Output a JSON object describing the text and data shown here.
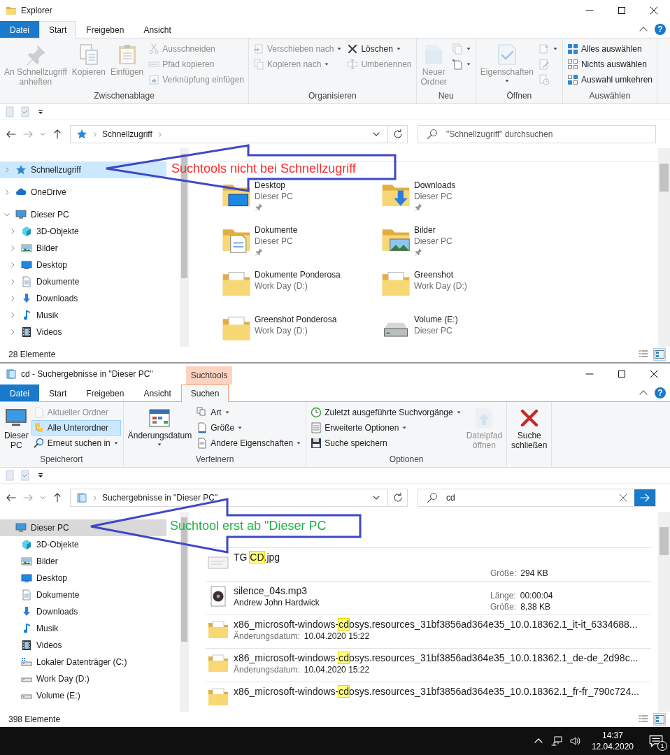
{
  "windows": [
    {
      "title": "Explorer",
      "nav_focus": true,
      "help": "?",
      "tabs": [
        {
          "label": "Datei",
          "kind": "file",
          "selected": false
        },
        {
          "label": "Start",
          "kind": "tab",
          "selected": true
        },
        {
          "label": "Freigeben",
          "kind": "tab",
          "selected": false
        },
        {
          "label": "Ansicht",
          "kind": "tab",
          "selected": false
        }
      ],
      "ribbon": [
        {
          "label": "Zwischenablage",
          "columns": [
            {
              "kind": "large",
              "label": "An Schnellzugriff\nanheften",
              "disabled": true
            },
            {
              "kind": "large",
              "label": "Kopieren",
              "disabled": true
            },
            {
              "kind": "large",
              "label": "Einfügen",
              "disabled": true
            },
            {
              "kind": "stack",
              "items": [
                {
                  "label": "Ausschneiden",
                  "disabled": true
                },
                {
                  "label": "Pfad kopieren",
                  "disabled": true
                },
                {
                  "label": "Verknüpfung einfügen",
                  "disabled": true
                }
              ]
            }
          ]
        },
        {
          "label": "Organisieren",
          "columns": [
            {
              "kind": "stack",
              "items": [
                {
                  "label": "Verschieben nach",
                  "disabled": true,
                  "dropdown": true
                },
                {
                  "label": "Kopieren nach",
                  "disabled": true,
                  "dropdown": true
                }
              ]
            },
            {
              "kind": "stack",
              "items": [
                {
                  "label": "Löschen",
                  "disabled": false,
                  "dropdown": true
                },
                {
                  "label": "Umbenennen",
                  "disabled": true
                }
              ]
            }
          ]
        },
        {
          "label": "Neu",
          "columns": [
            {
              "kind": "large",
              "label": "Neuer\nOrdner",
              "disabled": true
            },
            {
              "kind": "stack",
              "items": [
                {
                  "disabled": true,
                  "dropdown": true
                },
                {
                  "disabled": false,
                  "dropdown": true
                }
              ]
            }
          ]
        },
        {
          "label": "Öffnen",
          "columns": [
            {
              "kind": "large",
              "label": "Eigenschaften",
              "disabled": true,
              "dropdown": true
            },
            {
              "kind": "stack",
              "items": [
                {
                  "disabled": true,
                  "dropdown": true
                },
                {
                  "disabled": true
                },
                {
                  "disabled": true
                }
              ]
            }
          ]
        },
        {
          "label": "Auswählen",
          "columns": [
            {
              "kind": "stack",
              "items": [
                {
                  "label": "Alles auswählen",
                  "disabled": false
                },
                {
                  "label": "Nichts auswählen",
                  "disabled": false
                },
                {
                  "label": "Auswahl umkehren",
                  "disabled": false
                }
              ]
            }
          ]
        }
      ],
      "address": {
        "crumbs": [
          "Schnellzugriff"
        ],
        "trailing_chevron": true
      },
      "search": {
        "placeholder": "\"Schnellzugriff\" durchsuchen"
      },
      "nav": [
        {
          "label": "Schnellzugriff",
          "expanded": false,
          "selected": true
        },
        {
          "label": "OneDrive",
          "expanded": false,
          "selected": false
        },
        {
          "label": "Dieser PC",
          "expanded": true,
          "selected": false,
          "children": [
            {
              "label": "3D-Objekte",
              "expanded": false,
              "selected": false
            },
            {
              "label": "Bilder",
              "expanded": false,
              "selected": false
            },
            {
              "label": "Desktop",
              "expanded": false,
              "selected": false
            },
            {
              "label": "Dokumente",
              "expanded": false,
              "selected": false
            },
            {
              "label": "Downloads",
              "expanded": false,
              "selected": false
            },
            {
              "label": "Musik",
              "expanded": false,
              "selected": false
            },
            {
              "label": "Videos",
              "expanded": false,
              "selected": false
            }
          ]
        }
      ],
      "content": {
        "kind": "tiles",
        "tiles": [
          {
            "name": "Desktop",
            "location": "Dieser PC",
            "pinned": true
          },
          {
            "name": "Downloads",
            "location": "Dieser PC",
            "pinned": true
          },
          {
            "name": "Dokumente",
            "location": "Dieser PC",
            "pinned": true
          },
          {
            "name": "Bilder",
            "location": "Dieser PC",
            "pinned": true
          },
          {
            "name": "Dokumente Ponderosa",
            "location": "Work Day (D:)",
            "pinned": false
          },
          {
            "name": "Greenshot",
            "location": "Work Day (D:)",
            "pinned": false
          },
          {
            "name": "Greenshot Ponderosa",
            "location": "Work Day (D:)",
            "pinned": false
          },
          {
            "name": "Volume (E:)",
            "location": "Dieser PC",
            "pinned": false
          }
        ]
      },
      "status": "28 Elemente"
    },
    {
      "title": "cd - Suchergebnisse in \"Dieser PC\"",
      "context_label": "Suchtools",
      "nav_focus": false,
      "help": "?",
      "tabs": [
        {
          "label": "Datei",
          "kind": "file",
          "selected": false
        },
        {
          "label": "Start",
          "kind": "tab",
          "selected": false
        },
        {
          "label": "Freigeben",
          "kind": "tab",
          "selected": false
        },
        {
          "label": "Ansicht",
          "kind": "tab",
          "selected": false
        },
        {
          "label": "Suchen",
          "kind": "context",
          "selected": true
        }
      ],
      "ribbon": [
        {
          "label": "Speicherort",
          "columns": [
            {
              "kind": "large",
              "label": "Dieser\nPC",
              "disabled": false
            },
            {
              "kind": "stack",
              "items": [
                {
                  "label": "Aktueller Ordner",
                  "disabled": true,
                  "selected": false
                },
                {
                  "label": "Alle Unterordner",
                  "disabled": false,
                  "selected": true
                },
                {
                  "label": "Erneut suchen in",
                  "disabled": false,
                  "selected": false,
                  "dropdown": true
                }
              ]
            }
          ]
        },
        {
          "label": "Verfeinern",
          "columns": [
            {
              "kind": "large",
              "label": "Änderungsdatum",
              "disabled": false,
              "dropdown": true
            },
            {
              "kind": "stack",
              "items": [
                {
                  "label": "Art",
                  "disabled": false,
                  "dropdown": true
                },
                {
                  "label": "Größe",
                  "disabled": false,
                  "dropdown": true
                },
                {
                  "label": "Andere Eigenschaften",
                  "disabled": false,
                  "dropdown": true
                }
              ]
            }
          ]
        },
        {
          "label": "Optionen",
          "columns": [
            {
              "kind": "stack",
              "items": [
                {
                  "label": "Zuletzt ausgeführte Suchvorgänge",
                  "disabled": false,
                  "dropdown": true
                },
                {
                  "label": "Erweiterte Optionen",
                  "disabled": false,
                  "dropdown": true
                },
                {
                  "label": "Suche speichern",
                  "disabled": false
                }
              ]
            },
            {
              "kind": "large",
              "label": "Dateipfad\nöffnen",
              "disabled": true
            }
          ]
        },
        {
          "columns": [
            {
              "kind": "large",
              "label": "Suche\nschließen",
              "disabled": false
            }
          ]
        }
      ],
      "address": {
        "crumbs": [
          "Suchergebnisse in \"Dieser PC\""
        ],
        "trailing_chevron": false
      },
      "search": {
        "value": "cd"
      },
      "nav": [
        {
          "label": "Dieser PC",
          "selected": true,
          "children": [
            {
              "label": "3D-Objekte",
              "selected": false
            },
            {
              "label": "Bilder",
              "selected": false
            },
            {
              "label": "Desktop",
              "selected": false
            },
            {
              "label": "Dokumente",
              "selected": false
            },
            {
              "label": "Downloads",
              "selected": false
            },
            {
              "label": "Musik",
              "selected": false
            },
            {
              "label": "Videos",
              "selected": false
            },
            {
              "label": "Lokaler Datenträger (C:)",
              "selected": false
            },
            {
              "label": "Work Day (D:)",
              "selected": false
            },
            {
              "label": "Volume (E:)",
              "selected": false
            }
          ]
        }
      ],
      "content": {
        "kind": "results",
        "results": [
          {
            "name_parts": [
              {
                "text": "TG ",
                "match": false
              },
              {
                "text": "CD",
                "match": true
              },
              {
                "text": ".jpg",
                "match": false
              }
            ],
            "properties": [
              {
                "label": "Größe:",
                "value": "294 KB"
              }
            ]
          },
          {
            "name_parts": [
              {
                "text": "silence_04s.mp3",
                "match": false
              }
            ],
            "subtitle": "Andrew John Hardwick",
            "properties": [
              {
                "label": "Länge:",
                "value": "00:00:04"
              },
              {
                "label": "Größe:",
                "value": "8,38 KB"
              }
            ]
          },
          {
            "name_parts": [
              {
                "text": "x86_microsoft-windows-",
                "match": false
              },
              {
                "text": "cd",
                "match": true
              },
              {
                "text": "osys.resources_31bf3856ad364e35_10.0.18362.1_it-it_6334688...",
                "match": false
              }
            ],
            "details": [
              {
                "label": "Änderungsdatum:",
                "value": "10.04.2020 15:22"
              }
            ]
          },
          {
            "name_parts": [
              {
                "text": "x86_microsoft-windows-",
                "match": false
              },
              {
                "text": "cd",
                "match": true
              },
              {
                "text": "osys.resources_31bf3856ad364e35_10.0.18362.1_de-de_2d98c...",
                "match": false
              }
            ],
            "details": [
              {
                "label": "Änderungsdatum:",
                "value": "10.04.2020 15:22"
              }
            ]
          },
          {
            "name_parts": [
              {
                "text": "x86_microsoft-windows-",
                "match": false
              },
              {
                "text": "cd",
                "match": true
              },
              {
                "text": "osys.resources_31bf3856ad364e35_10.0.18362.1_fr-fr_790c724...",
                "match": false
              }
            ]
          }
        ]
      },
      "status": "398 Elemente"
    }
  ],
  "annotations": [
    {
      "text": "Suchtools nicht bei Schnellzugriff",
      "color": "#ff2a2a"
    },
    {
      "text": "Suchtool erst ab \"Dieser PC",
      "color": "#22b14c"
    }
  ],
  "taskbar": {
    "time": "14:37",
    "date": "12.04.2020",
    "notifications": "1"
  }
}
